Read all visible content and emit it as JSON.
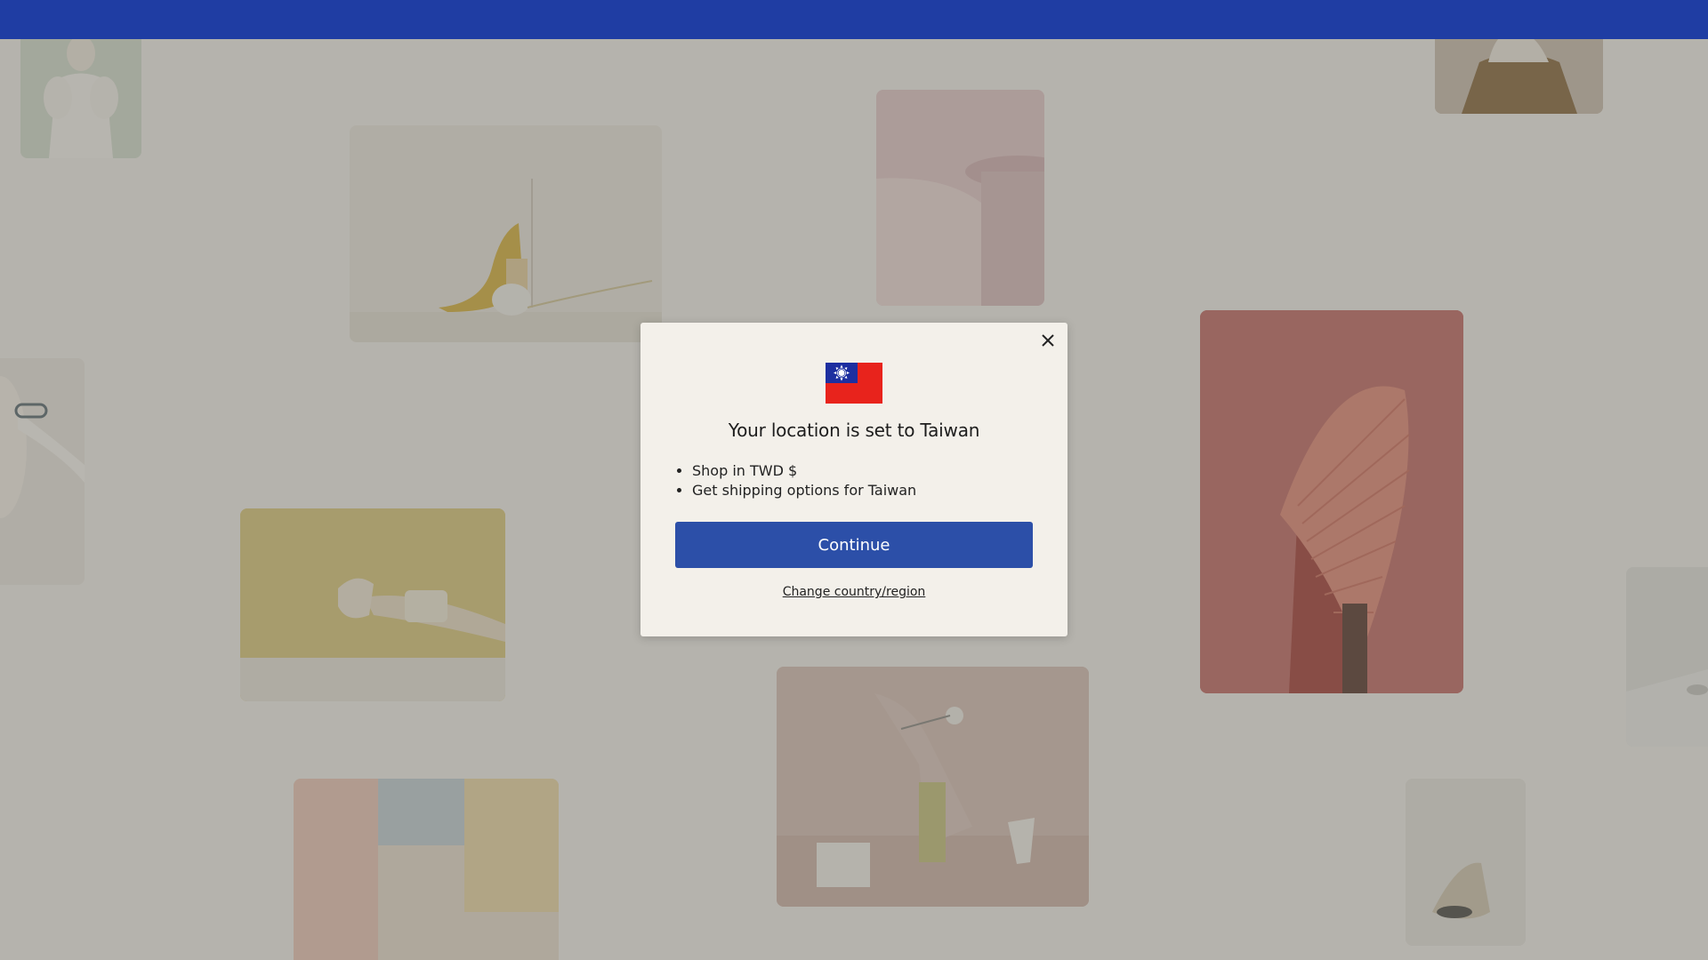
{
  "header": {
    "bar_color": "#1f3da3"
  },
  "background_tiles": [
    {
      "name": "tile-woman-white-dress",
      "color": "#dfe3d6"
    },
    {
      "name": "tile-yellow-heel-sculpture",
      "color": "#ece8df"
    },
    {
      "name": "tile-pink-arch",
      "color": "#e7cfd0"
    },
    {
      "name": "tile-brown-figure",
      "color": "#b9a28c"
    },
    {
      "name": "tile-hand-ring",
      "color": "#e9e4dc"
    },
    {
      "name": "tile-red-fan-figure",
      "color": "#c8726a"
    },
    {
      "name": "tile-yellow-arm-cuffs",
      "color": "#d8c77c"
    },
    {
      "name": "tile-pink-cubes",
      "color": "#d9c2b8"
    },
    {
      "name": "tile-grey-right-edge",
      "color": "#e4e3df"
    },
    {
      "name": "tile-pastel-blocks",
      "color": "#e2d6c4"
    },
    {
      "name": "tile-small-sculpture",
      "color": "#e6e2da"
    }
  ],
  "modal": {
    "title": "Your location is set to Taiwan",
    "perks": [
      "Shop in TWD $",
      "Get shipping options for Taiwan"
    ],
    "continue_label": "Continue",
    "change_label": "Change country/region",
    "flag": {
      "name": "taiwan-flag-icon",
      "colors": {
        "red": "#e8231c",
        "blue": "#1d2fa0",
        "white": "#ffffff"
      }
    },
    "close_icon": "close-icon",
    "accent_color": "#2c4fa8"
  }
}
